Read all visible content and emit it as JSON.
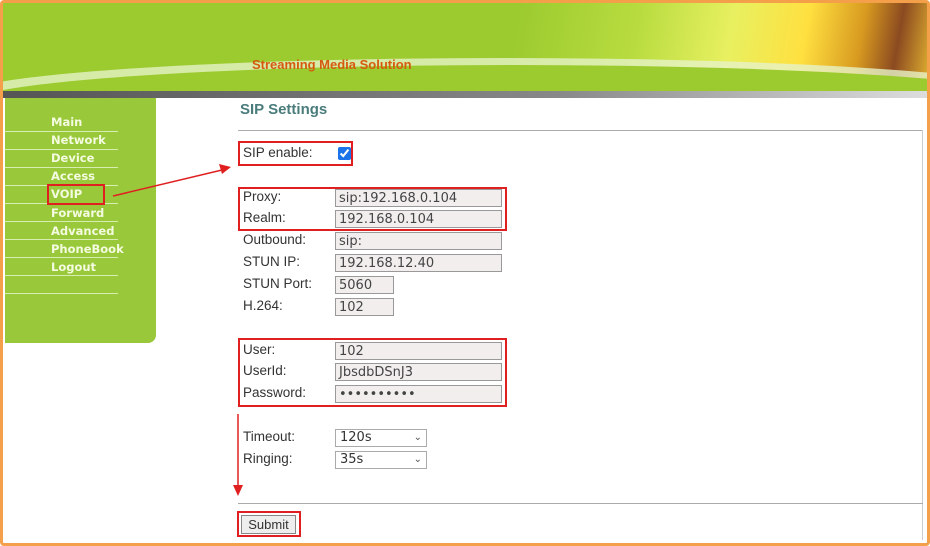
{
  "banner": {
    "title": "Streaming Media Solution"
  },
  "sidebar": {
    "items": [
      {
        "label": "Main"
      },
      {
        "label": "Network"
      },
      {
        "label": "Device"
      },
      {
        "label": "Access"
      },
      {
        "label": "VOIP"
      },
      {
        "label": "Forward"
      },
      {
        "label": "Advanced"
      },
      {
        "label": "PhoneBook"
      },
      {
        "label": "Logout"
      }
    ]
  },
  "page": {
    "title": "SIP Settings"
  },
  "form": {
    "sip_enable": {
      "label": "SIP enable:",
      "checked": true
    },
    "proxy": {
      "label": "Proxy:",
      "value": "sip:192.168.0.104"
    },
    "realm": {
      "label": "Realm:",
      "value": "192.168.0.104"
    },
    "outbound": {
      "label": "Outbound:",
      "value": "sip:"
    },
    "stun_ip": {
      "label": "STUN IP:",
      "value": "192.168.12.40"
    },
    "stun_port": {
      "label": "STUN Port:",
      "value": "5060"
    },
    "h264": {
      "label": "H.264:",
      "value": "102"
    },
    "user": {
      "label": "User:",
      "value": "102"
    },
    "userid": {
      "label": "UserId:",
      "value": "JbsdbDSnJ3"
    },
    "password": {
      "label": "Password:",
      "value": "••••••••••"
    },
    "timeout": {
      "label": "Timeout:",
      "value": "120s"
    },
    "ringing": {
      "label": "Ringing:",
      "value": "35s"
    },
    "submit": "Submit"
  },
  "colors": {
    "accent_green": "#99c93a",
    "highlight_red": "#e02020",
    "frame_orange": "#f4a04a"
  }
}
